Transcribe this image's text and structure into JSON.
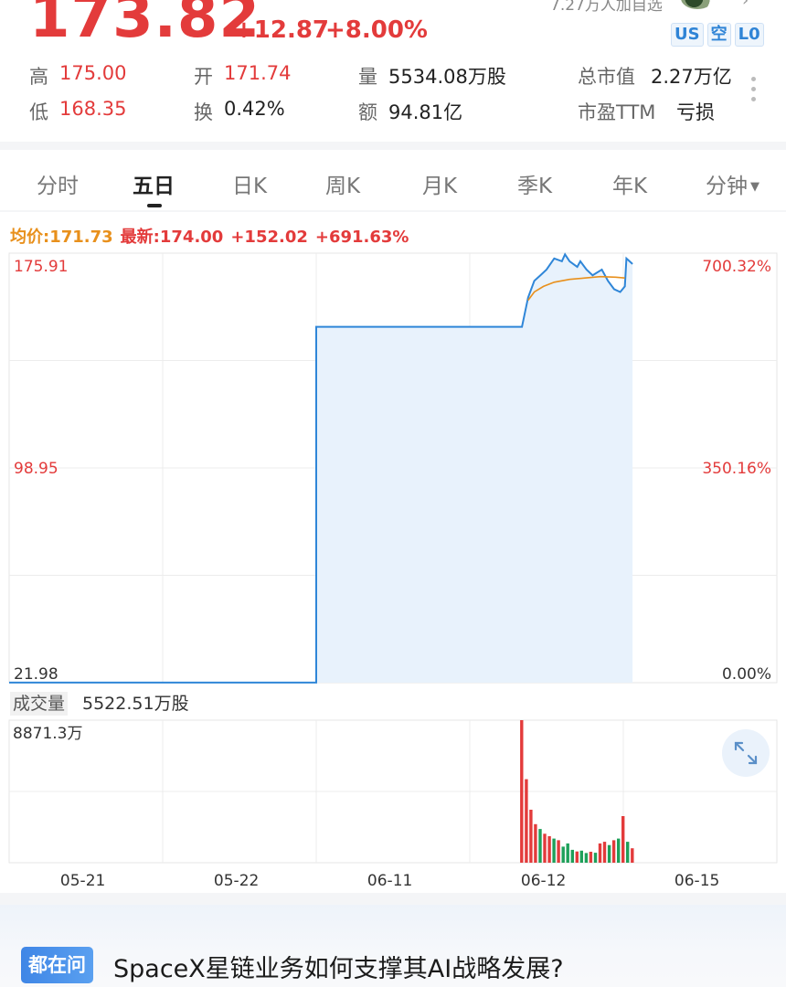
{
  "quote": {
    "price": "173.82",
    "change": "+12.87",
    "change_pct": "+8.00%",
    "top_note": "7.27万人加自选",
    "tags": [
      "US",
      "空",
      "L0"
    ],
    "stats": {
      "high_label": "高",
      "high": "175.00",
      "low_label": "低",
      "low": "168.35",
      "open_label": "开",
      "open": "171.74",
      "turnover_label": "换",
      "turnover": "0.42%",
      "volume_label": "量",
      "volume": "5534.08万股",
      "amount_label": "额",
      "amount": "94.81亿",
      "mktcap_label": "总市值",
      "mktcap": "2.27万亿",
      "pe_label": "市盈TTM",
      "pe": "亏损"
    }
  },
  "tabs": [
    "分时",
    "五日",
    "日K",
    "周K",
    "月K",
    "季K",
    "年K",
    "分钟"
  ],
  "active_tab": "五日",
  "legend": {
    "avg": "均价:171.73",
    "latest": "最新:174.00",
    "change": "+152.02",
    "change_pct": "+691.63%"
  },
  "volume_header": {
    "label": "成交量",
    "value": "5522.51万股",
    "max_label": "8871.3万"
  },
  "ask": {
    "badge": "都在问",
    "question": "SpaceX星链业务如何支撑其AI战略发展?"
  },
  "colors": {
    "up": "#e33b3b",
    "down": "#1fa05a",
    "price_line": "#2f86d8",
    "avg_line": "#e8901c",
    "accent": "#2f84d6"
  },
  "chart_data": {
    "type": "line",
    "x_labels": [
      "05-21",
      "05-22",
      "06-11",
      "06-12",
      "06-15"
    ],
    "y_left_ticks": [
      "175.91",
      "98.95",
      "21.98"
    ],
    "y_right_ticks": [
      "700.32%",
      "350.16%",
      "0.00%"
    ],
    "ylim": [
      21.98,
      175.91
    ],
    "series": [
      {
        "key": "price",
        "points": [
          [
            0,
            22.0
          ],
          [
            1,
            22.0
          ],
          [
            2,
            22.0
          ],
          [
            2.0,
            149.5
          ],
          [
            2.5,
            149.5
          ],
          [
            3.0,
            149.5
          ],
          [
            3.34,
            149.5
          ],
          [
            3.38,
            160
          ],
          [
            3.42,
            166
          ],
          [
            3.46,
            168
          ],
          [
            3.5,
            170
          ],
          [
            3.55,
            174
          ],
          [
            3.6,
            173
          ],
          [
            3.62,
            175.5
          ],
          [
            3.65,
            173
          ],
          [
            3.7,
            171
          ],
          [
            3.72,
            173
          ],
          [
            3.76,
            170
          ],
          [
            3.8,
            168
          ],
          [
            3.86,
            170
          ],
          [
            3.9,
            166
          ],
          [
            3.94,
            163
          ],
          [
            3.98,
            162
          ],
          [
            4.01,
            164
          ],
          [
            4.02,
            174
          ],
          [
            4.06,
            172
          ]
        ]
      },
      {
        "key": "avg",
        "points": [
          [
            3.38,
            159
          ],
          [
            3.42,
            162
          ],
          [
            3.48,
            164
          ],
          [
            3.55,
            165.5
          ],
          [
            3.65,
            166.5
          ],
          [
            3.75,
            167
          ],
          [
            3.85,
            167.5
          ],
          [
            3.95,
            167.3
          ],
          [
            4.01,
            167
          ]
        ]
      }
    ],
    "volume": {
      "max": 8871.3,
      "unit": "万",
      "bars": [
        {
          "x": 3.34,
          "v": 8871.3,
          "d": "up"
        },
        {
          "x": 3.37,
          "v": 5200,
          "d": "up"
        },
        {
          "x": 3.4,
          "v": 3300,
          "d": "up"
        },
        {
          "x": 3.43,
          "v": 2400,
          "d": "up"
        },
        {
          "x": 3.46,
          "v": 2100,
          "d": "down"
        },
        {
          "x": 3.49,
          "v": 1800,
          "d": "up"
        },
        {
          "x": 3.52,
          "v": 1650,
          "d": "up"
        },
        {
          "x": 3.55,
          "v": 1500,
          "d": "down"
        },
        {
          "x": 3.58,
          "v": 1400,
          "d": "up"
        },
        {
          "x": 3.61,
          "v": 1000,
          "d": "down"
        },
        {
          "x": 3.64,
          "v": 1200,
          "d": "down"
        },
        {
          "x": 3.67,
          "v": 800,
          "d": "down"
        },
        {
          "x": 3.7,
          "v": 700,
          "d": "up"
        },
        {
          "x": 3.73,
          "v": 750,
          "d": "down"
        },
        {
          "x": 3.76,
          "v": 600,
          "d": "down"
        },
        {
          "x": 3.79,
          "v": 680,
          "d": "up"
        },
        {
          "x": 3.82,
          "v": 620,
          "d": "down"
        },
        {
          "x": 3.85,
          "v": 1200,
          "d": "up"
        },
        {
          "x": 3.88,
          "v": 1300,
          "d": "up"
        },
        {
          "x": 3.91,
          "v": 1100,
          "d": "down"
        },
        {
          "x": 3.94,
          "v": 1400,
          "d": "up"
        },
        {
          "x": 3.97,
          "v": 1500,
          "d": "down"
        },
        {
          "x": 4.0,
          "v": 2900,
          "d": "up"
        },
        {
          "x": 4.03,
          "v": 1300,
          "d": "down"
        },
        {
          "x": 4.06,
          "v": 900,
          "d": "up"
        }
      ]
    }
  }
}
